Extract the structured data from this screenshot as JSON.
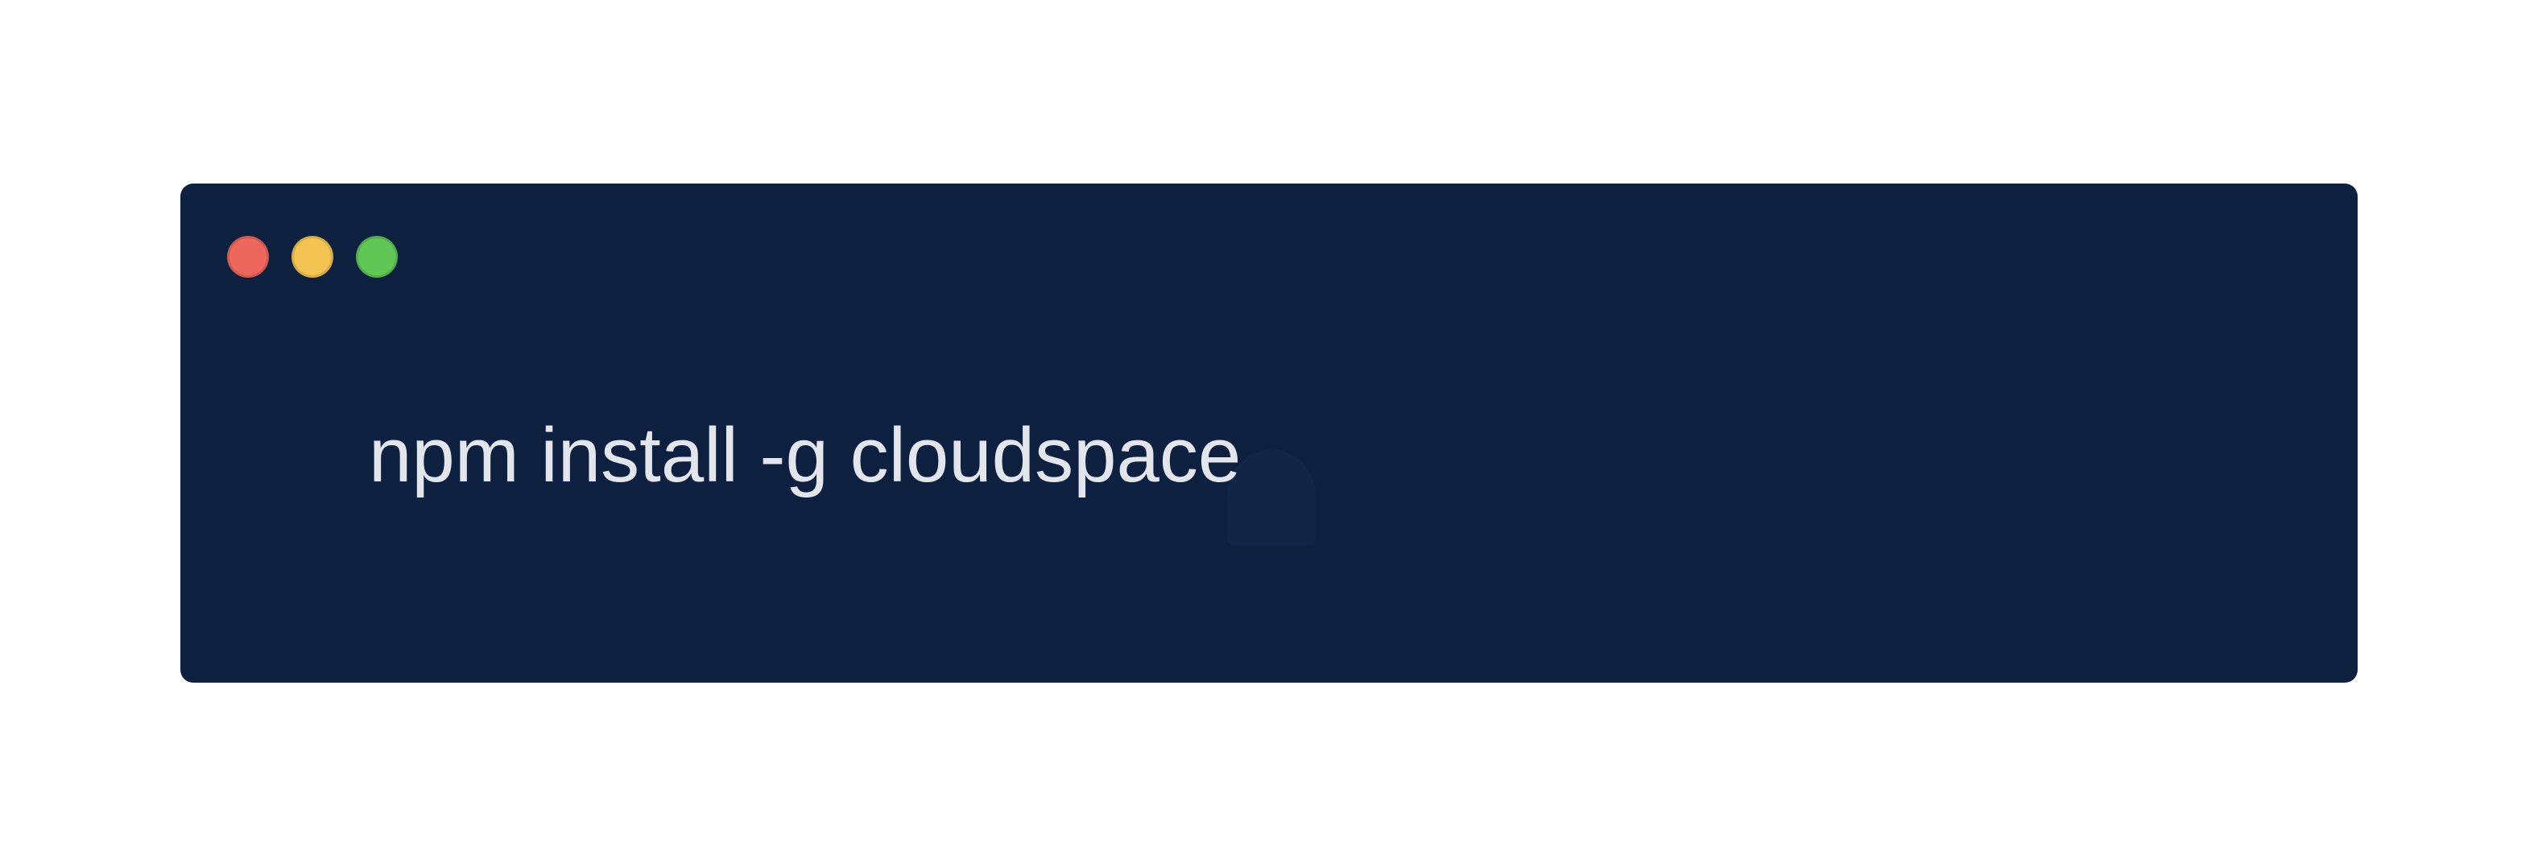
{
  "terminal": {
    "background_color": "#0d2040",
    "text_color": "#e2e6ec",
    "window_controls": [
      {
        "name": "close-button",
        "color": "#ee675c"
      },
      {
        "name": "minimize-button",
        "color": "#f3c452"
      },
      {
        "name": "zoom-button",
        "color": "#60c756"
      }
    ],
    "command": "npm install -g cloudspace"
  }
}
